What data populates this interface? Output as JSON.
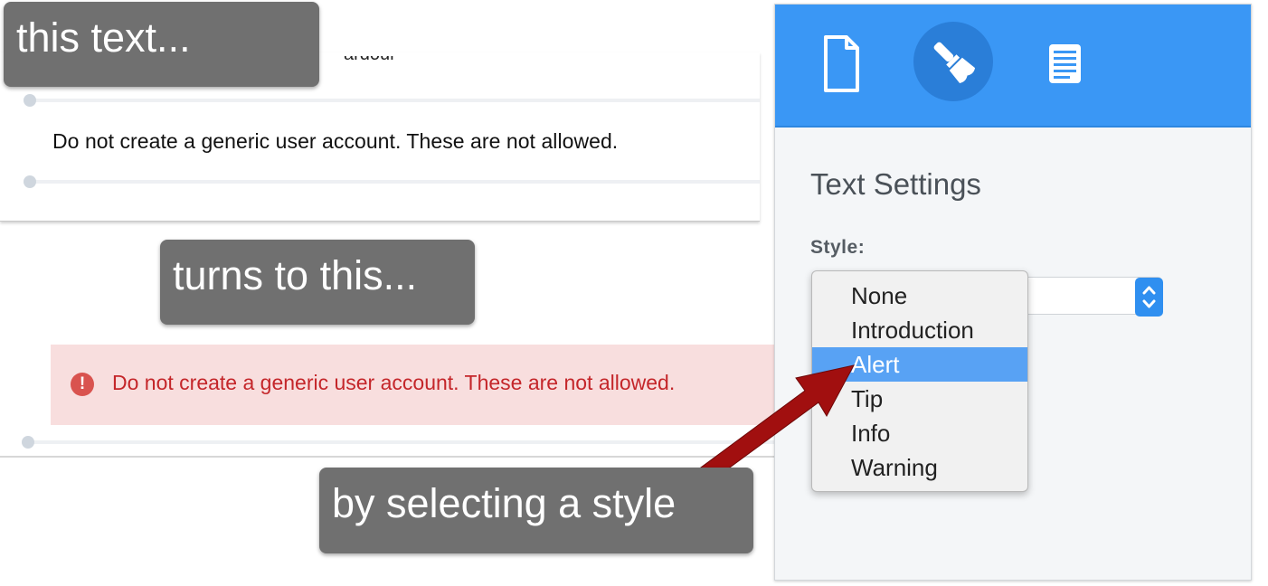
{
  "editor": {
    "partial_text": "ardour",
    "block_text": "Do not create a generic user account. These are not allowed.",
    "alert_icon": "!",
    "alert_text": "Do not create a generic user account. These are not allowed."
  },
  "callouts": {
    "first": "this text...",
    "second": "turns to this...",
    "third": "by selecting a style"
  },
  "panel": {
    "tabs": [
      {
        "icon": "page-icon",
        "active": false
      },
      {
        "icon": "brush-icon",
        "active": true
      },
      {
        "icon": "document-lines-icon",
        "active": false
      }
    ],
    "title": "Text Settings",
    "style_label": "Style:",
    "style_options": [
      "None",
      "Introduction",
      "Alert",
      "Tip",
      "Info",
      "Warning"
    ],
    "selected_option": "Alert"
  },
  "colors": {
    "header_blue": "#3a97f5",
    "alert_bg": "#f8dede",
    "alert_text": "#c4262a",
    "callout_bg": "#707070",
    "arrow": "#a10f0f",
    "menu_highlight": "#58a2f4"
  }
}
